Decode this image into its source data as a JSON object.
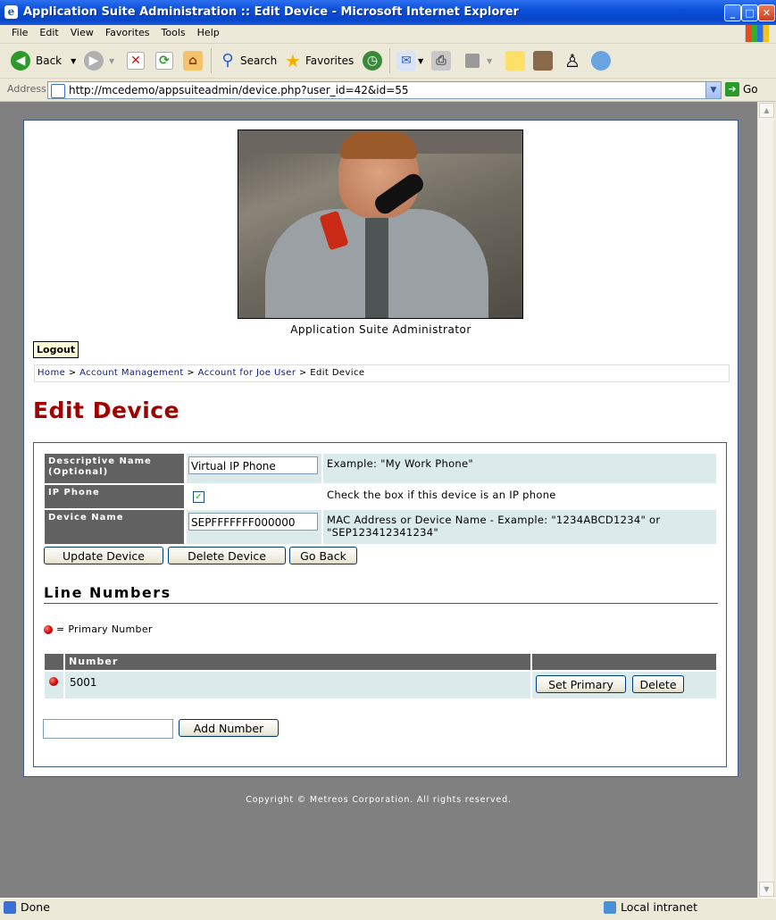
{
  "window": {
    "title": "Application Suite Administration :: Edit Device - Microsoft Internet Explorer"
  },
  "menu": [
    "File",
    "Edit",
    "View",
    "Favorites",
    "Tools",
    "Help"
  ],
  "toolbar": {
    "back": "Back",
    "search": "Search",
    "favorites": "Favorites"
  },
  "address": {
    "label": "Address",
    "url": "http://mcedemo/appsuiteadmin/device.php?user_id=42&id=55",
    "go": "Go"
  },
  "page": {
    "caption": "Application Suite Administrator",
    "logout": "Logout",
    "breadcrumb": {
      "home": "Home",
      "sep": " > ",
      "account_mgmt": "Account Management",
      "account": "Account for Joe User",
      "current": "Edit Device"
    },
    "heading": "Edit Device",
    "form": {
      "descriptive_name": {
        "label": "Descriptive Name (Optional)",
        "value": "Virtual IP Phone",
        "hint": "Example: \"My Work Phone\""
      },
      "ip_phone": {
        "label": "IP Phone",
        "checked": true,
        "hint": "Check the box if this device is an IP phone"
      },
      "device_name": {
        "label": "Device Name",
        "value": "SEPFFFFFFF000000",
        "hint": "MAC Address or Device Name - Example: \"1234ABCD1234\" or \"SEP123412341234\""
      }
    },
    "buttons": {
      "update": "Update Device",
      "delete": "Delete Device",
      "back": "Go Back"
    },
    "lines": {
      "heading": "Line Numbers",
      "legend": "= Primary Number",
      "column": "Number",
      "rows": [
        {
          "number": "5001",
          "primary": true,
          "set_primary": "Set Primary",
          "delete": "Delete"
        }
      ],
      "new_value": "",
      "add": "Add Number"
    },
    "copyright": "Copyright © Metreos Corporation. All rights reserved."
  },
  "status": {
    "text": "Done",
    "zone": "Local intranet"
  }
}
